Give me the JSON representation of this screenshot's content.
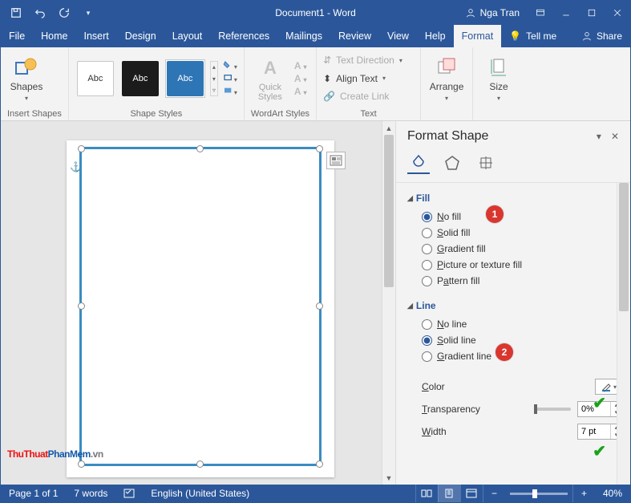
{
  "title": "Document1 - Word",
  "user": "Nga Tran",
  "qat": {
    "save": "Save",
    "undo": "Undo",
    "redo": "Redo"
  },
  "menu": {
    "file": "File",
    "home": "Home",
    "insert": "Insert",
    "design": "Design",
    "layout": "Layout",
    "references": "References",
    "mailings": "Mailings",
    "review": "Review",
    "view": "View",
    "help": "Help",
    "format": "Format",
    "tellme": "Tell me",
    "share": "Share"
  },
  "ribbon": {
    "insert_shapes": {
      "btn": "Shapes",
      "group": "Insert Shapes"
    },
    "shape_styles": {
      "abc": "Abc",
      "group": "Shape Styles"
    },
    "wordart": {
      "quick": "Quick\nStyles",
      "group": "WordArt Styles"
    },
    "text": {
      "direction": "Text Direction",
      "align": "Align Text",
      "link": "Create Link",
      "group": "Text"
    },
    "arrange": {
      "btn": "Arrange"
    },
    "size": {
      "btn": "Size"
    }
  },
  "pane": {
    "title": "Format Shape",
    "fill": {
      "header": "Fill",
      "nofill": "No fill",
      "solid": "Solid fill",
      "gradient": "Gradient fill",
      "picture": "Picture or texture fill",
      "pattern": "Pattern fill",
      "selected": "nofill"
    },
    "line": {
      "header": "Line",
      "noline": "No line",
      "solid": "Solid line",
      "gradient": "Gradient line",
      "selected": "solid"
    },
    "color_label": "Color",
    "transparency_label": "Transparency",
    "transparency_value": "0%",
    "width_label": "Width",
    "width_value": "7 pt"
  },
  "callouts": {
    "one": "1",
    "two": "2"
  },
  "status": {
    "page": "Page 1 of 1",
    "words": "7 words",
    "lang": "English (United States)",
    "zoom": "40%"
  },
  "watermark": {
    "a": "ThuThuat",
    "b": "PhanMem",
    "c": ".vn"
  }
}
